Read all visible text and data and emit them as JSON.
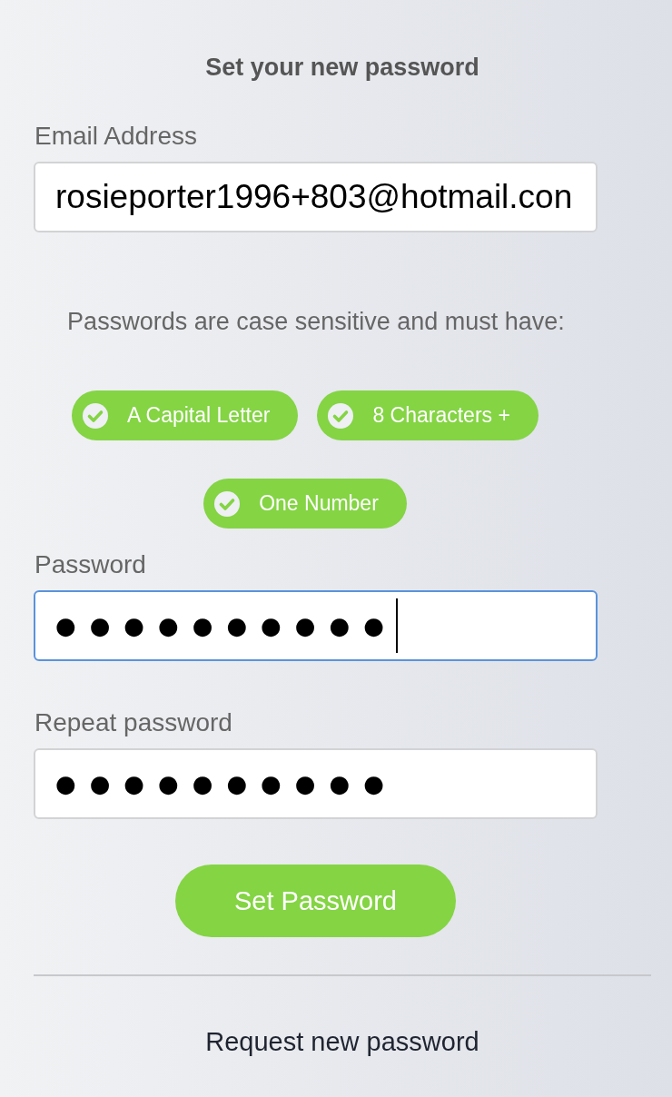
{
  "title": "Set your new password",
  "email": {
    "label": "Email Address",
    "value": "rosieporter1996+803@hotmail.con",
    "focused": false
  },
  "hint": "Passwords are case sensitive and must have:",
  "requirements": [
    {
      "label": "A Capital Letter",
      "met": true
    },
    {
      "label": "8 Characters +",
      "met": true
    },
    {
      "label": "One Number",
      "met": true
    }
  ],
  "password": {
    "label": "Password",
    "value": "●●●●●●●●●●",
    "focused": true
  },
  "repeat_password": {
    "label": "Repeat password",
    "value": "●●●●●●●●●●",
    "focused": false
  },
  "submit_button": "Set Password",
  "request_link": "Request new password"
}
